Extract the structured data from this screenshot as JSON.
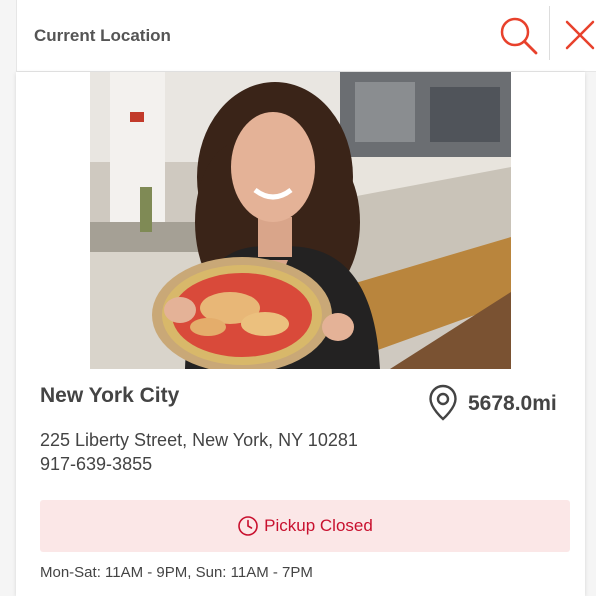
{
  "colors": {
    "accent": "#e8412c",
    "status_text": "#c8102e",
    "status_bg": "#fbe7e7",
    "text": "#444444"
  },
  "search": {
    "placeholder": "Current Location",
    "search_icon": "search-icon",
    "close_icon": "close-icon"
  },
  "location": {
    "photo": "woman-holding-pizza-photo",
    "name": "New York City",
    "distance": "5678.0mi",
    "address": "225 Liberty Street, New York, NY 10281",
    "phone": "917-639-3855",
    "status": {
      "icon": "clock-icon",
      "label": "Pickup Closed"
    },
    "hours": "Mon-Sat: 11AM - 9PM, Sun: 11AM - 7PM"
  }
}
